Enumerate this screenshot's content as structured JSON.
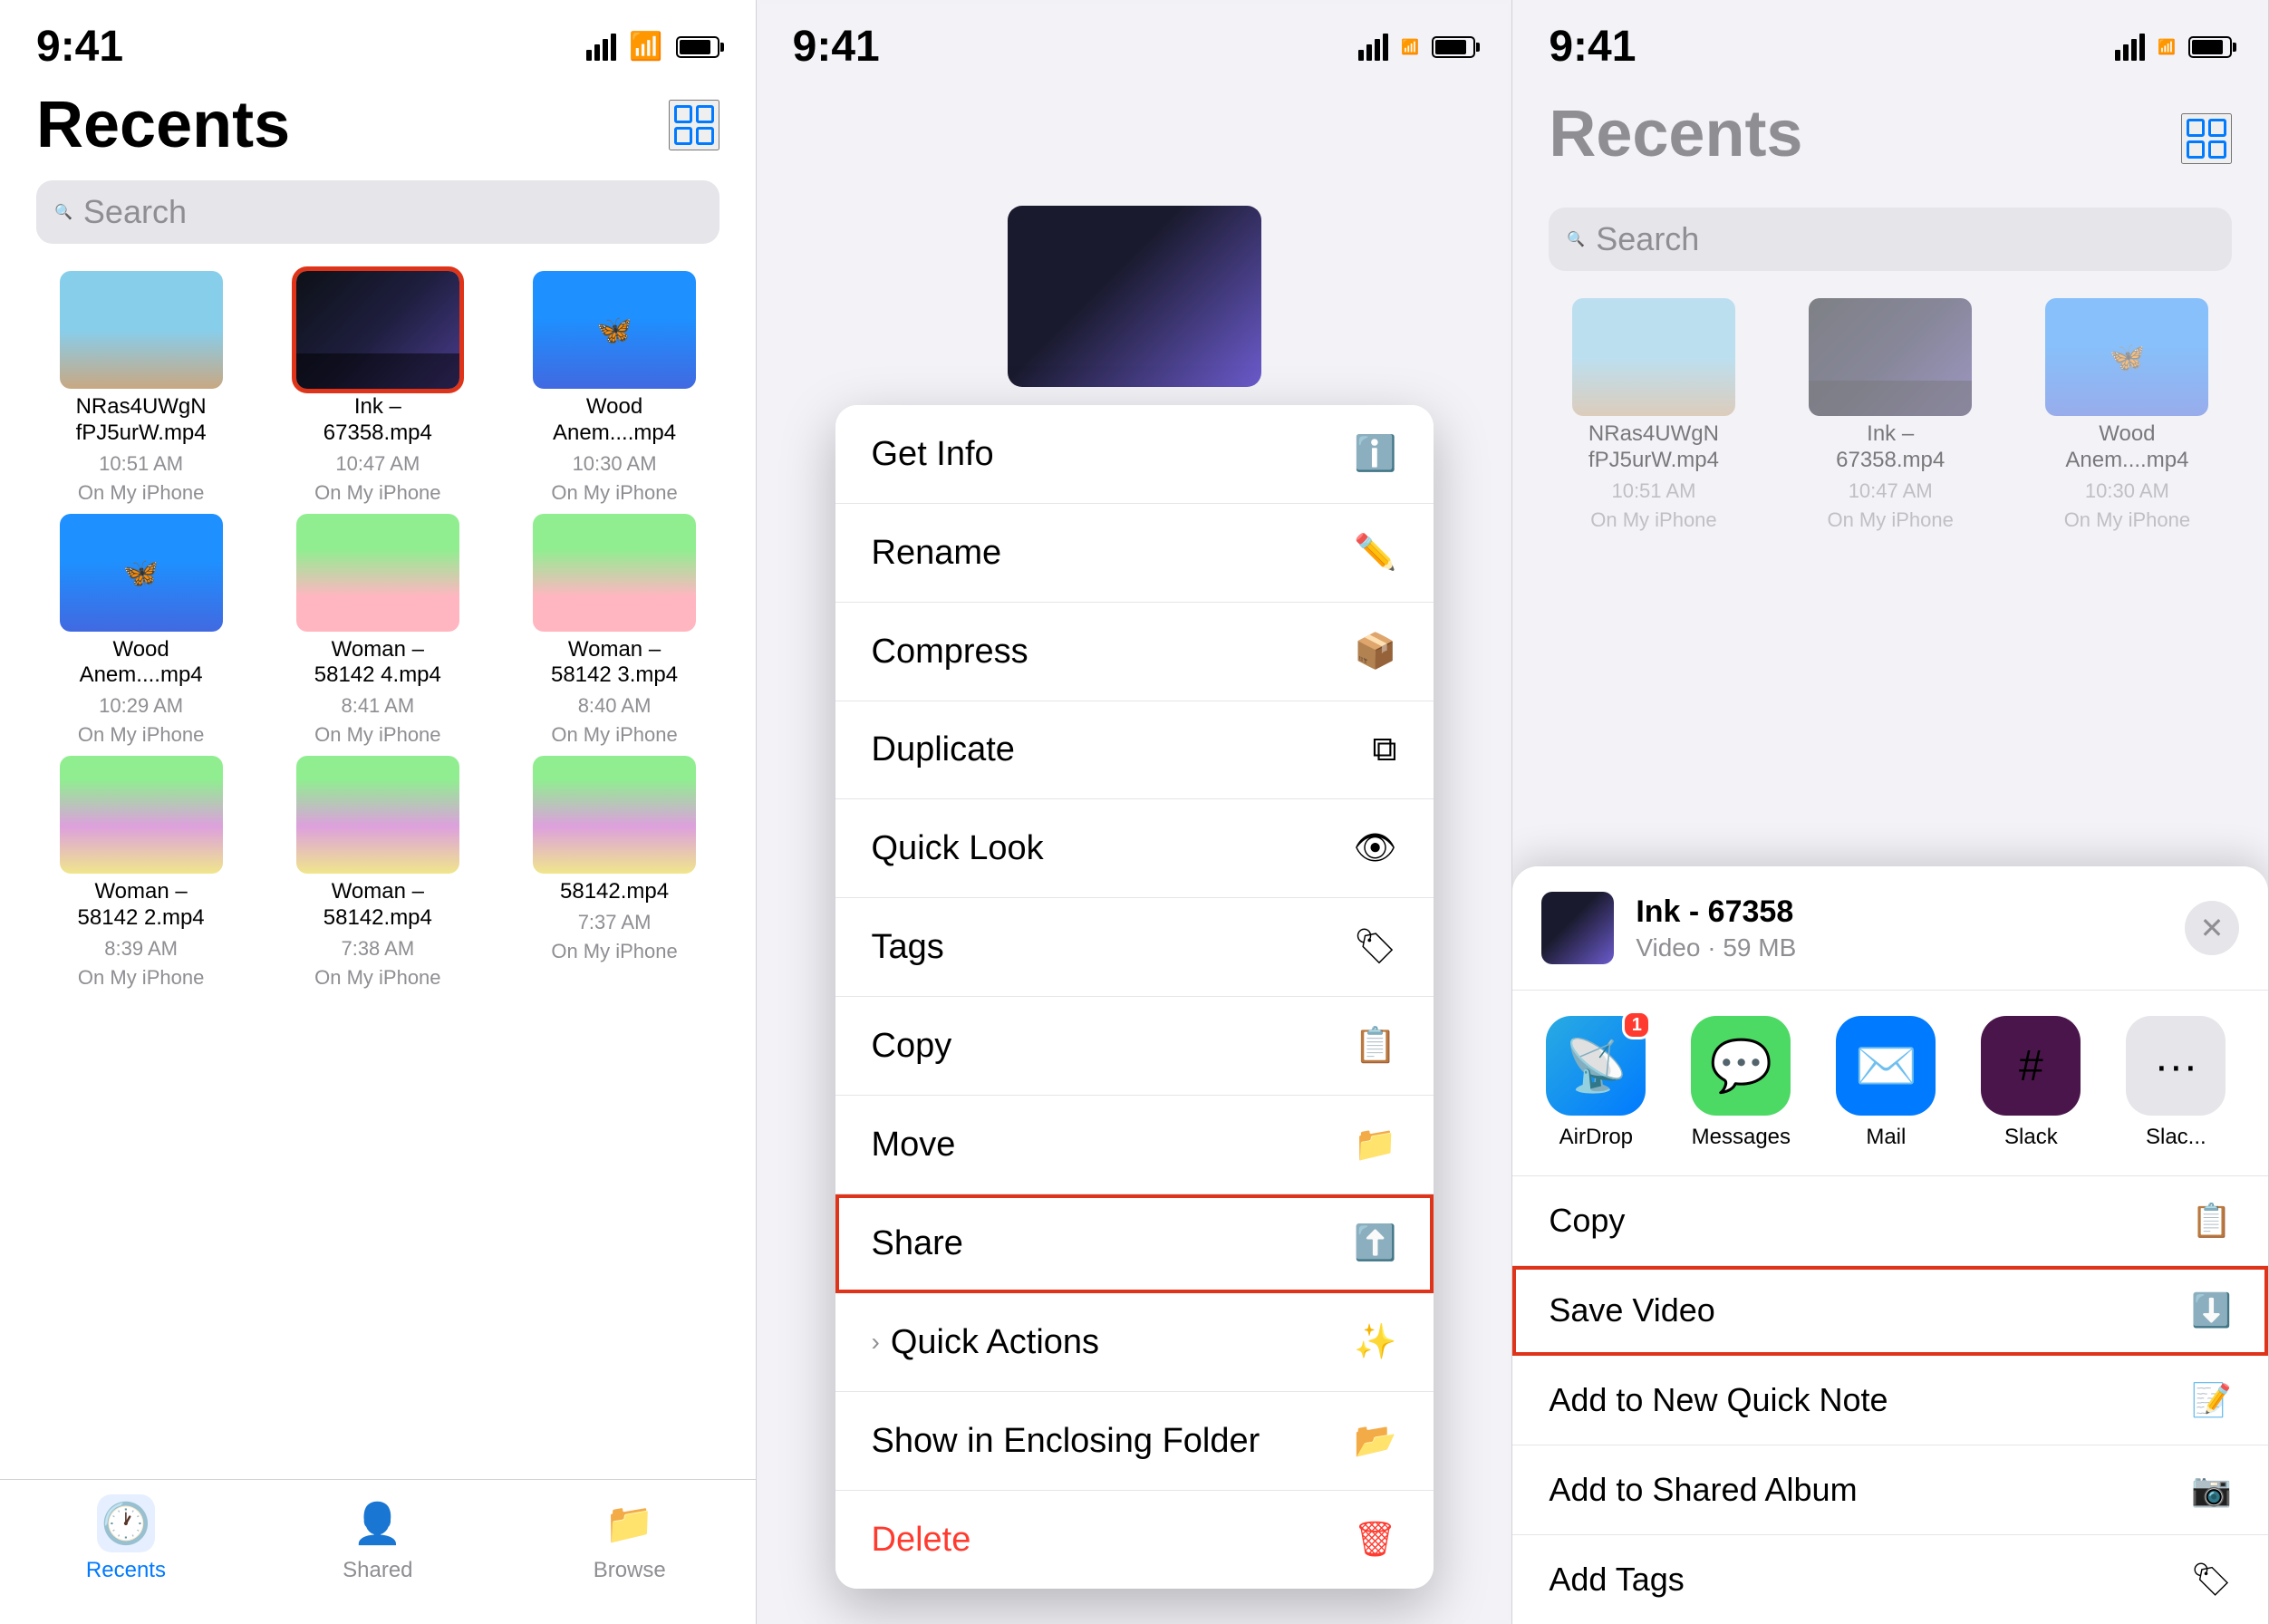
{
  "panel1": {
    "status": {
      "time": "9:41"
    },
    "title": "Recents",
    "search": {
      "placeholder": "Search"
    },
    "files": [
      {
        "name": "NRas4UWgNfPJ5urW.mp4",
        "time": "10:51 AM",
        "location": "On My iPhone",
        "thumb": "beach",
        "selected": false
      },
      {
        "name": "Ink - 67358.mp4",
        "time": "10:47 AM",
        "location": "On My iPhone",
        "thumb": "dark",
        "selected": true
      },
      {
        "name": "Wood Anem....mp4",
        "time": "10:30 AM",
        "location": "On My iPhone",
        "thumb": "butterfly",
        "selected": false
      },
      {
        "name": "Wood Anem....mp4",
        "time": "10:29 AM",
        "location": "On My iPhone",
        "thumb": "butterfly",
        "selected": false
      },
      {
        "name": "Woman - 58142 4.mp4",
        "time": "8:41 AM",
        "location": "On My iPhone",
        "thumb": "flowers",
        "selected": false
      },
      {
        "name": "Woman - 58142 3.mp4",
        "time": "8:40 AM",
        "location": "On My iPhone",
        "thumb": "flowers",
        "selected": false
      },
      {
        "name": "Woman - 58142 2.mp4",
        "time": "8:39 AM",
        "location": "On My iPhone",
        "thumb": "feet",
        "selected": false
      },
      {
        "name": "Woman - 58142.mp4",
        "time": "7:38 AM",
        "location": "On My iPhone",
        "thumb": "feet",
        "selected": false
      },
      {
        "name": "58142.mp4",
        "time": "7:37 AM",
        "location": "On My iPhone",
        "thumb": "feet",
        "selected": false
      }
    ],
    "tabs": [
      {
        "id": "recents",
        "label": "Recents",
        "active": true
      },
      {
        "id": "shared",
        "label": "Shared",
        "active": false
      },
      {
        "id": "browse",
        "label": "Browse",
        "active": false
      }
    ]
  },
  "panel2": {
    "status": {
      "time": "9:41"
    },
    "menu_items": [
      {
        "id": "get-info",
        "label": "Get Info",
        "icon": "ℹ️",
        "danger": false,
        "highlighted": false
      },
      {
        "id": "rename",
        "label": "Rename",
        "icon": "✏️",
        "danger": false,
        "highlighted": false
      },
      {
        "id": "compress",
        "label": "Compress",
        "icon": "🗜",
        "danger": false,
        "highlighted": false
      },
      {
        "id": "duplicate",
        "label": "Duplicate",
        "icon": "⧉",
        "danger": false,
        "highlighted": false
      },
      {
        "id": "quick-look",
        "label": "Quick Look",
        "icon": "👁",
        "danger": false,
        "highlighted": false
      },
      {
        "id": "tags",
        "label": "Tags",
        "icon": "🏷",
        "danger": false,
        "highlighted": false
      },
      {
        "id": "copy",
        "label": "Copy",
        "icon": "📋",
        "danger": false,
        "highlighted": false
      },
      {
        "id": "move",
        "label": "Move",
        "icon": "📁",
        "danger": false,
        "highlighted": false
      },
      {
        "id": "share",
        "label": "Share",
        "icon": "⬆️",
        "danger": false,
        "highlighted": true
      },
      {
        "id": "quick-actions",
        "label": "Quick Actions",
        "icon": "✨",
        "danger": false,
        "highlighted": false,
        "expandable": true
      },
      {
        "id": "show-enclosing",
        "label": "Show in Enclosing Folder",
        "icon": "📂",
        "danger": false,
        "highlighted": false
      },
      {
        "id": "delete",
        "label": "Delete",
        "icon": "🗑",
        "danger": true,
        "highlighted": false
      }
    ]
  },
  "panel3": {
    "status": {
      "time": "9:41"
    },
    "title": "Recents",
    "search": {
      "placeholder": "Search"
    },
    "files": [
      {
        "name": "NRas4UWgNfPJ5urW.mp4",
        "time": "10:51 AM",
        "location": "On My iPhone",
        "thumb": "beach"
      },
      {
        "name": "Ink - 67358.mp4",
        "time": "10:47 AM",
        "location": "On My iPhone",
        "thumb": "dark"
      },
      {
        "name": "Wood Anem....mp4",
        "time": "10:30 AM",
        "location": "On My iPhone",
        "thumb": "butterfly"
      }
    ],
    "share_sheet": {
      "file_name": "Ink - 67358",
      "file_meta": "Video · 59 MB",
      "apps": [
        {
          "id": "airdrop",
          "label": "AirDrop",
          "badge": "1"
        },
        {
          "id": "messages",
          "label": "Messages",
          "badge": null
        },
        {
          "id": "mail",
          "label": "Mail",
          "badge": null
        },
        {
          "id": "slack",
          "label": "Slack",
          "badge": null
        },
        {
          "id": "more",
          "label": "Slac...",
          "badge": null
        }
      ],
      "actions": [
        {
          "id": "copy",
          "label": "Copy",
          "icon": "📋",
          "highlighted": false
        },
        {
          "id": "save-video",
          "label": "Save Video",
          "icon": "⬇️",
          "highlighted": true
        },
        {
          "id": "add-quick-note",
          "label": "Add to New Quick Note",
          "icon": "📝",
          "highlighted": false
        },
        {
          "id": "add-shared-album",
          "label": "Add to Shared Album",
          "icon": "📷",
          "highlighted": false
        },
        {
          "id": "add-tags",
          "label": "Add Tags",
          "icon": "🏷",
          "highlighted": false
        }
      ]
    }
  }
}
